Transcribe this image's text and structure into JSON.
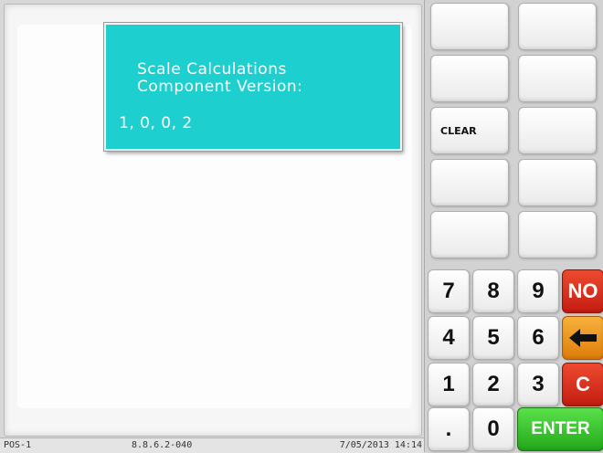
{
  "message": {
    "title_line1": "Scale Calculations",
    "title_line2": "Component Version:",
    "version": "1, 0, 0, 2"
  },
  "status_bar": {
    "terminal": "POS-1",
    "software_version": "8.8.6.2-040",
    "datetime": "7/05/2013 14:14"
  },
  "function_keys": {
    "clear_label": "CLEAR"
  },
  "keypad": {
    "k7": "7",
    "k8": "8",
    "k9": "9",
    "no": "NO",
    "k4": "4",
    "k5": "5",
    "k6": "6",
    "back": "←",
    "k1": "1",
    "k2": "2",
    "k3": "3",
    "c": "C",
    "dot": ".",
    "k0": "0",
    "enter": "ENTER"
  },
  "colors": {
    "message_box": "#1ecfcf",
    "no_key": "#d9281a",
    "back_key": "#ee9620",
    "c_key": "#d9281a",
    "enter_key": "#3cc232"
  },
  "icons": {
    "back_key": "left-arrow-icon"
  }
}
